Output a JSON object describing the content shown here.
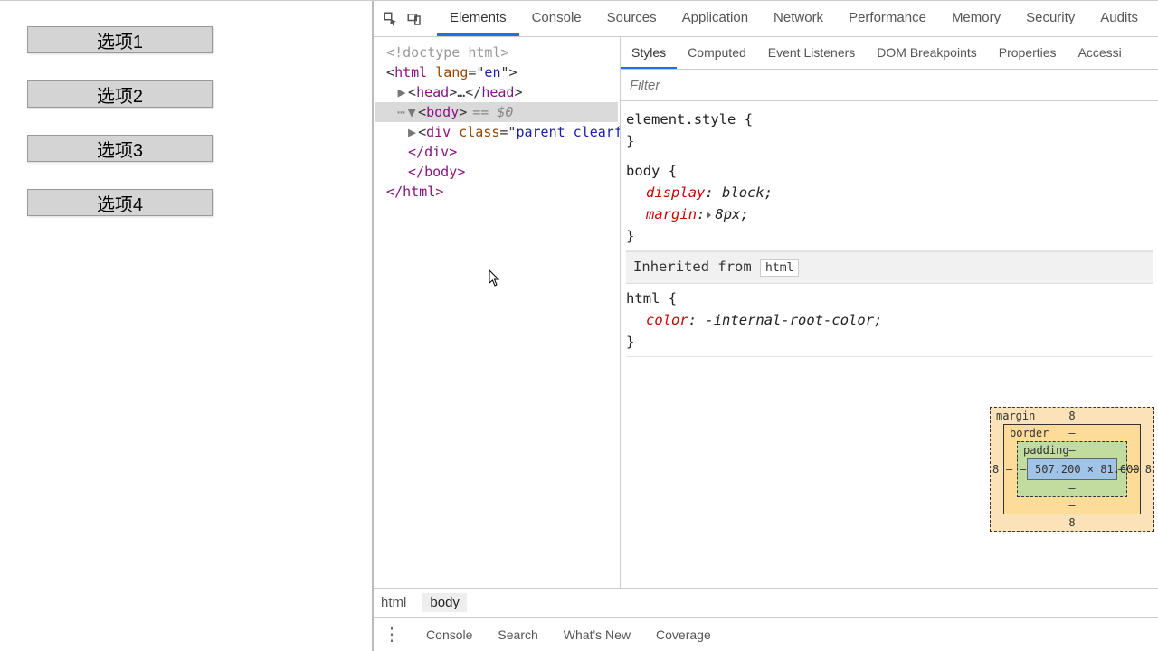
{
  "page": {
    "options": [
      "选项1",
      "选项2",
      "选项3",
      "选项4"
    ]
  },
  "devtools": {
    "tabs": [
      "Elements",
      "Console",
      "Sources",
      "Application",
      "Network",
      "Performance",
      "Memory",
      "Security",
      "Audits"
    ],
    "active_tab": "Elements",
    "styles_tabs": [
      "Styles",
      "Computed",
      "Event Listeners",
      "DOM Breakpoints",
      "Properties",
      "Accessi"
    ],
    "styles_active": "Styles",
    "filter_placeholder": "Filter",
    "dom": {
      "doctype": "<!doctype html>",
      "html_open": "html",
      "html_lang_attr": "lang",
      "html_lang_val": "en",
      "head": "head",
      "body": "body",
      "body_note": "== $0",
      "div_tag": "div",
      "div_class_attr": "class",
      "div_class_val": "parent clearfix",
      "div_close": "</div>",
      "body_close": "</body>",
      "html_close": "</html>"
    },
    "rules": {
      "element_style": "element.style",
      "body_sel": "body",
      "body_display_p": "display",
      "body_display_v": "block",
      "body_margin_p": "margin",
      "body_margin_v": "8px",
      "inherit_label": "Inherited from",
      "inherit_from": "html",
      "html_sel": "html",
      "html_color_p": "color",
      "html_color_v": "-internal-root-color"
    },
    "boxmodel": {
      "margin_label": "margin",
      "border_label": "border",
      "padding_label": "padding",
      "margin_t": "8",
      "margin_b": "8",
      "margin_l": "8",
      "margin_r": "8",
      "border_t": "–",
      "border_b": "–",
      "border_l": "–",
      "border_r": "–",
      "padding_t": "–",
      "padding_b": "–",
      "padding_l": "–",
      "padding_r": "–",
      "content": "507.200 × 81.600"
    },
    "crumb": {
      "html": "html",
      "body": "body"
    },
    "drawer": [
      "Console",
      "Search",
      "What's New",
      "Coverage"
    ]
  }
}
